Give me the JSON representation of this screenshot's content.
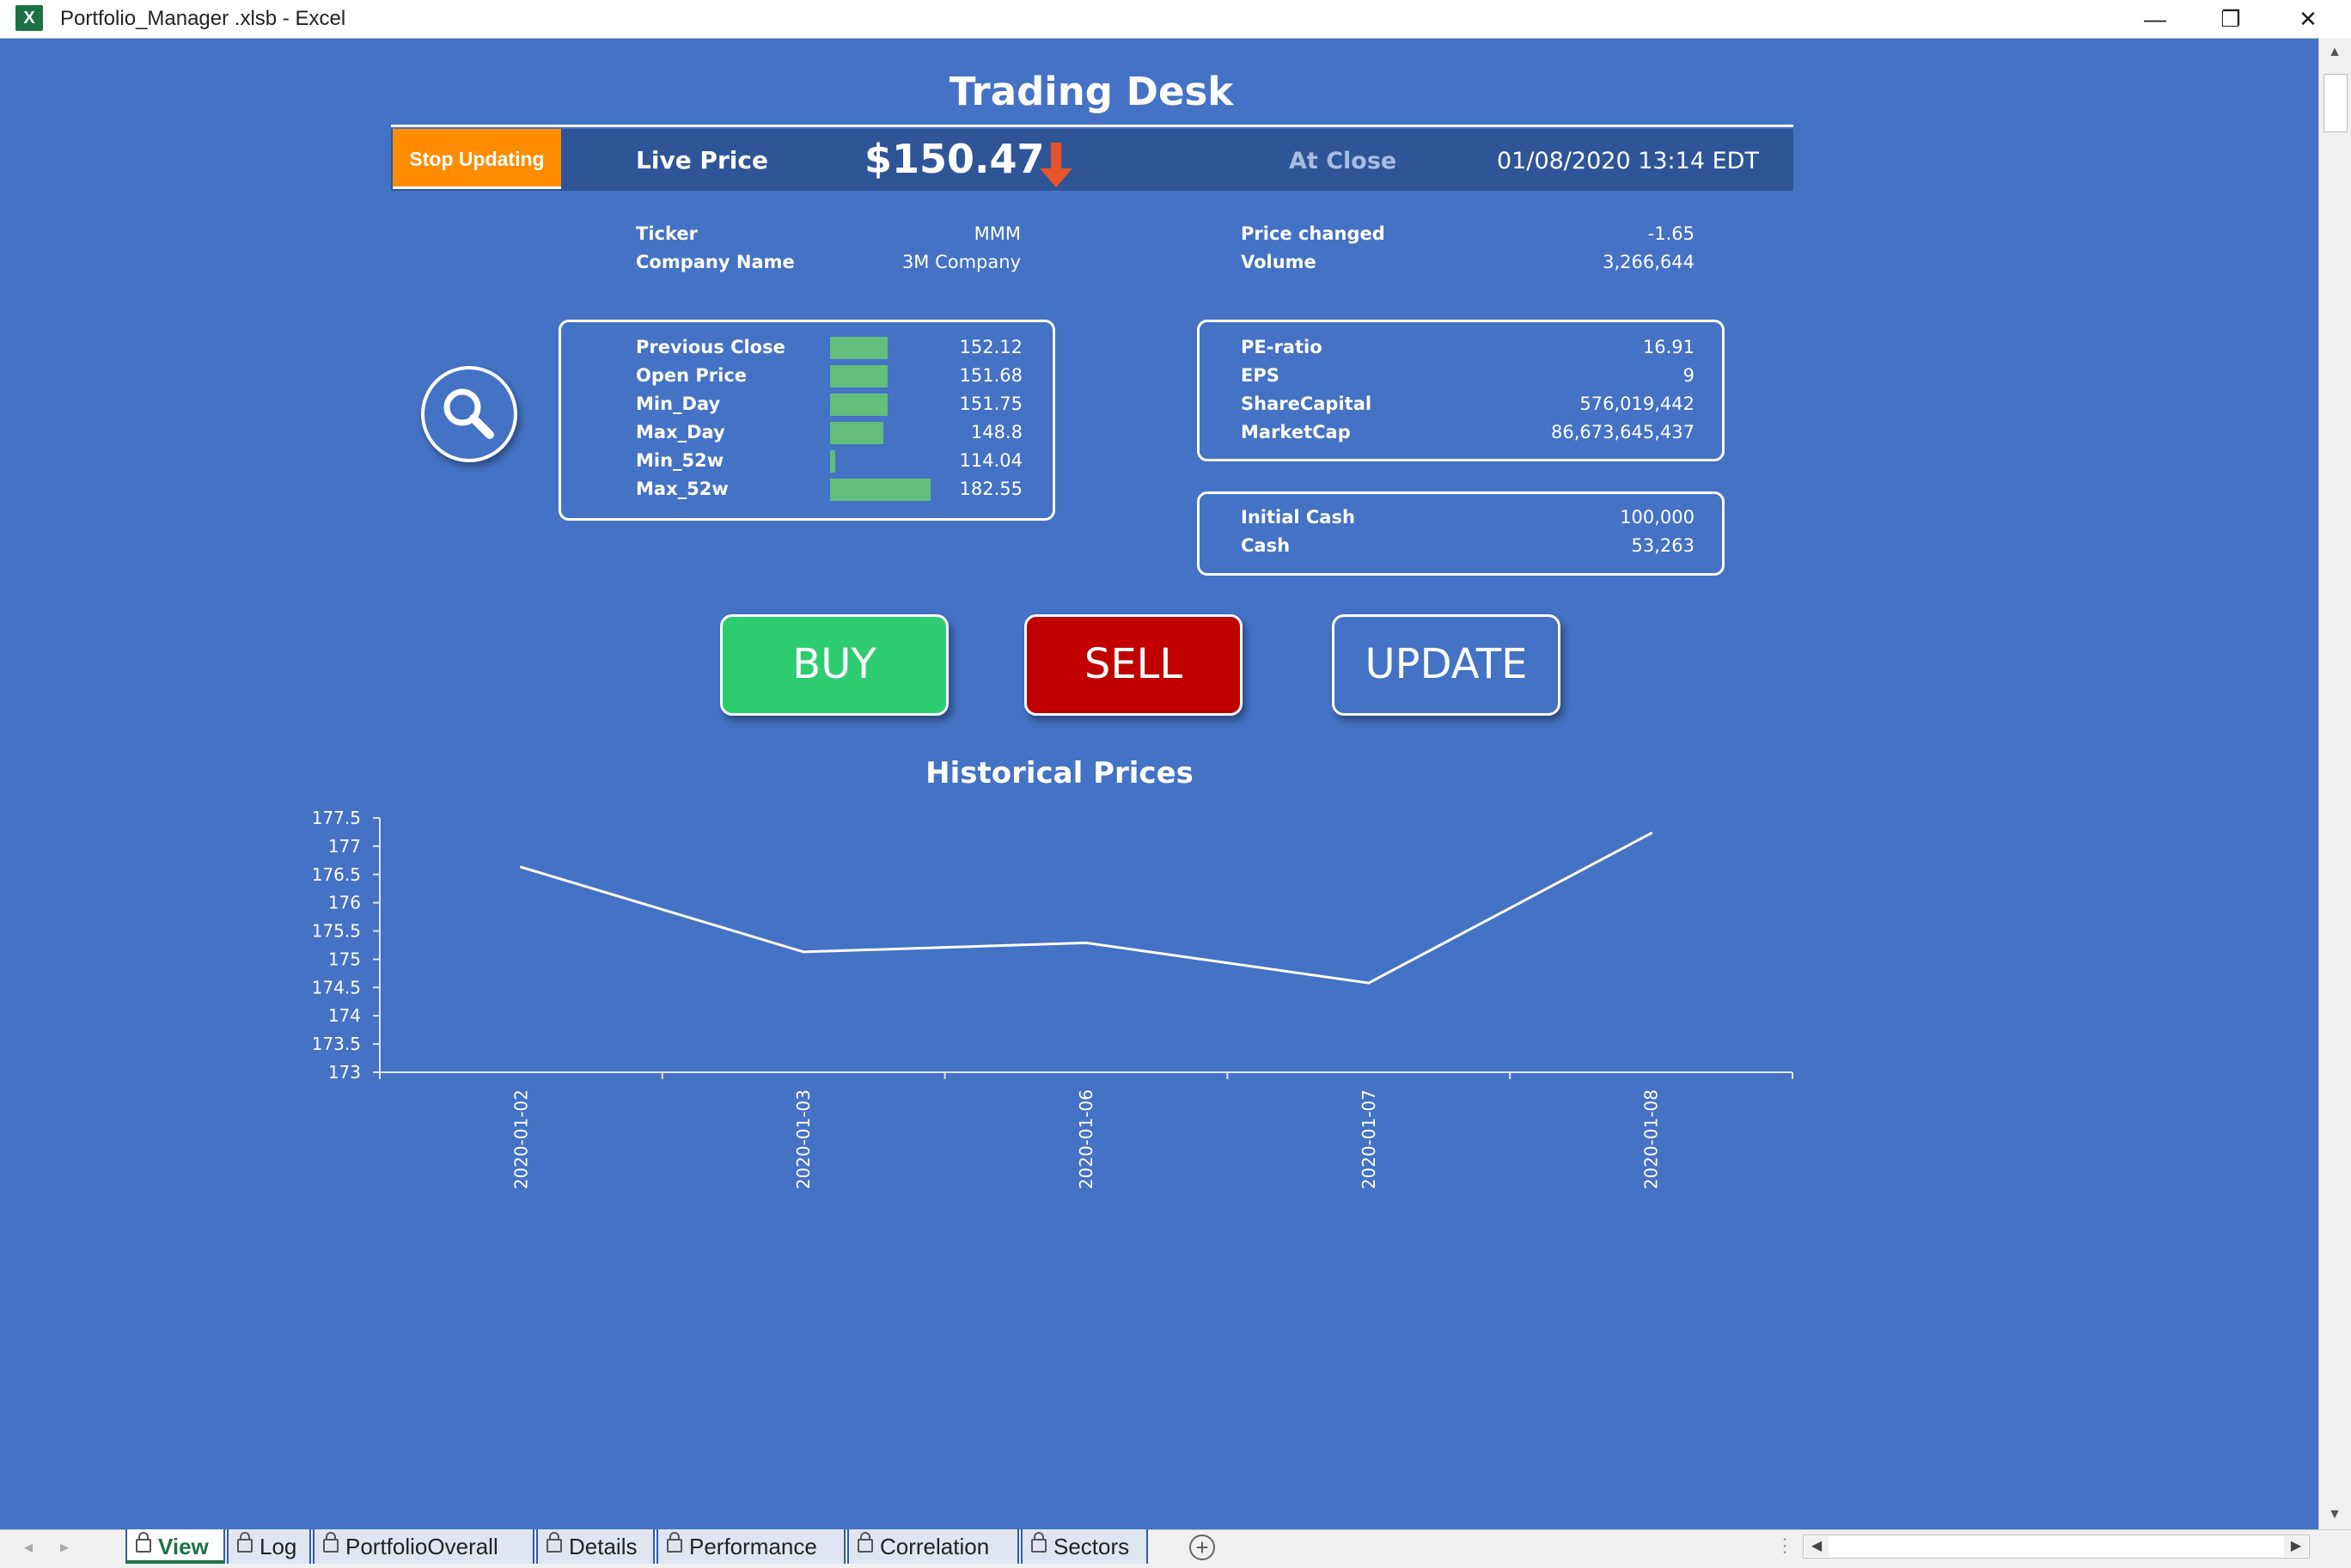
{
  "window": {
    "title": "Portfolio_Manager .xlsb - Excel",
    "app_icon": "excel-icon",
    "controls": {
      "minimize": "—",
      "restore": "❐",
      "close": "✕"
    }
  },
  "desk": {
    "title": "Trading Desk",
    "stop_button": "Stop Updating",
    "live_price_label": "Live Price",
    "live_price": "$150.47",
    "trend_icon": "arrow-down-icon",
    "market_status": "At Close",
    "timestamp": "01/08/2020 13:14 EDT"
  },
  "info": {
    "ticker_label": "Ticker",
    "ticker": "MMM",
    "company_label": "Company Name",
    "company": "3M Company",
    "price_changed_label": "Price changed",
    "price_changed": "-1.65",
    "volume_label": "Volume",
    "volume": "3,266,644"
  },
  "prices": [
    {
      "label": "Previous Close",
      "value": "152.12",
      "bar": 0.42
    },
    {
      "label": "Open Price",
      "value": "151.68",
      "bar": 0.42
    },
    {
      "label": "Min_Day",
      "value": "151.75",
      "bar": 0.42
    },
    {
      "label": "Max_Day",
      "value": "148.8",
      "bar": 0.39
    },
    {
      "label": "Min_52w",
      "value": "114.04",
      "bar": 0.04
    },
    {
      "label": "Max_52w",
      "value": "182.55",
      "bar": 0.73
    }
  ],
  "fundamentals": [
    {
      "label": "PE-ratio",
      "value": "16.91"
    },
    {
      "label": "EPS",
      "value": "9"
    },
    {
      "label": "ShareCapital",
      "value": "576,019,442"
    },
    {
      "label": "MarketCap",
      "value": "86,673,645,437"
    }
  ],
  "cash": [
    {
      "label": "Initial Cash",
      "value": "100,000"
    },
    {
      "label": "Cash",
      "value": "53,263"
    }
  ],
  "buttons": {
    "buy": "BUY",
    "sell": "SELL",
    "update": "UPDATE",
    "search_icon": "magnifier-icon"
  },
  "colors": {
    "background": "#4472c4",
    "header_band": "#2f5597",
    "stop": "#ff8c00",
    "buy": "#2ecc71",
    "sell": "#c00000",
    "databar": "#63be7b",
    "trend": "#e8542a"
  },
  "chart_data": {
    "type": "line",
    "title": "Historical Prices",
    "x": [
      "2020-01-02",
      "2020-01-03",
      "2020-01-06",
      "2020-01-07",
      "2020-01-08"
    ],
    "series": [
      {
        "values": [
          176.63,
          175.13,
          175.29,
          174.58,
          177.23
        ]
      }
    ],
    "ylim": [
      173,
      177.5
    ],
    "yticks": [
      "173",
      "173.5",
      "174",
      "174.5",
      "175",
      "175.5",
      "176",
      "176.5",
      "177",
      "177.5"
    ],
    "grid": false
  },
  "tabs": [
    {
      "label": "View",
      "active": true
    },
    {
      "label": "Log"
    },
    {
      "label": "PortfolioOverall"
    },
    {
      "label": "Details"
    },
    {
      "label": "Performance"
    },
    {
      "label": "Correlation"
    },
    {
      "label": "Sectors"
    }
  ],
  "add_sheet_icon": "plus-circle-icon"
}
